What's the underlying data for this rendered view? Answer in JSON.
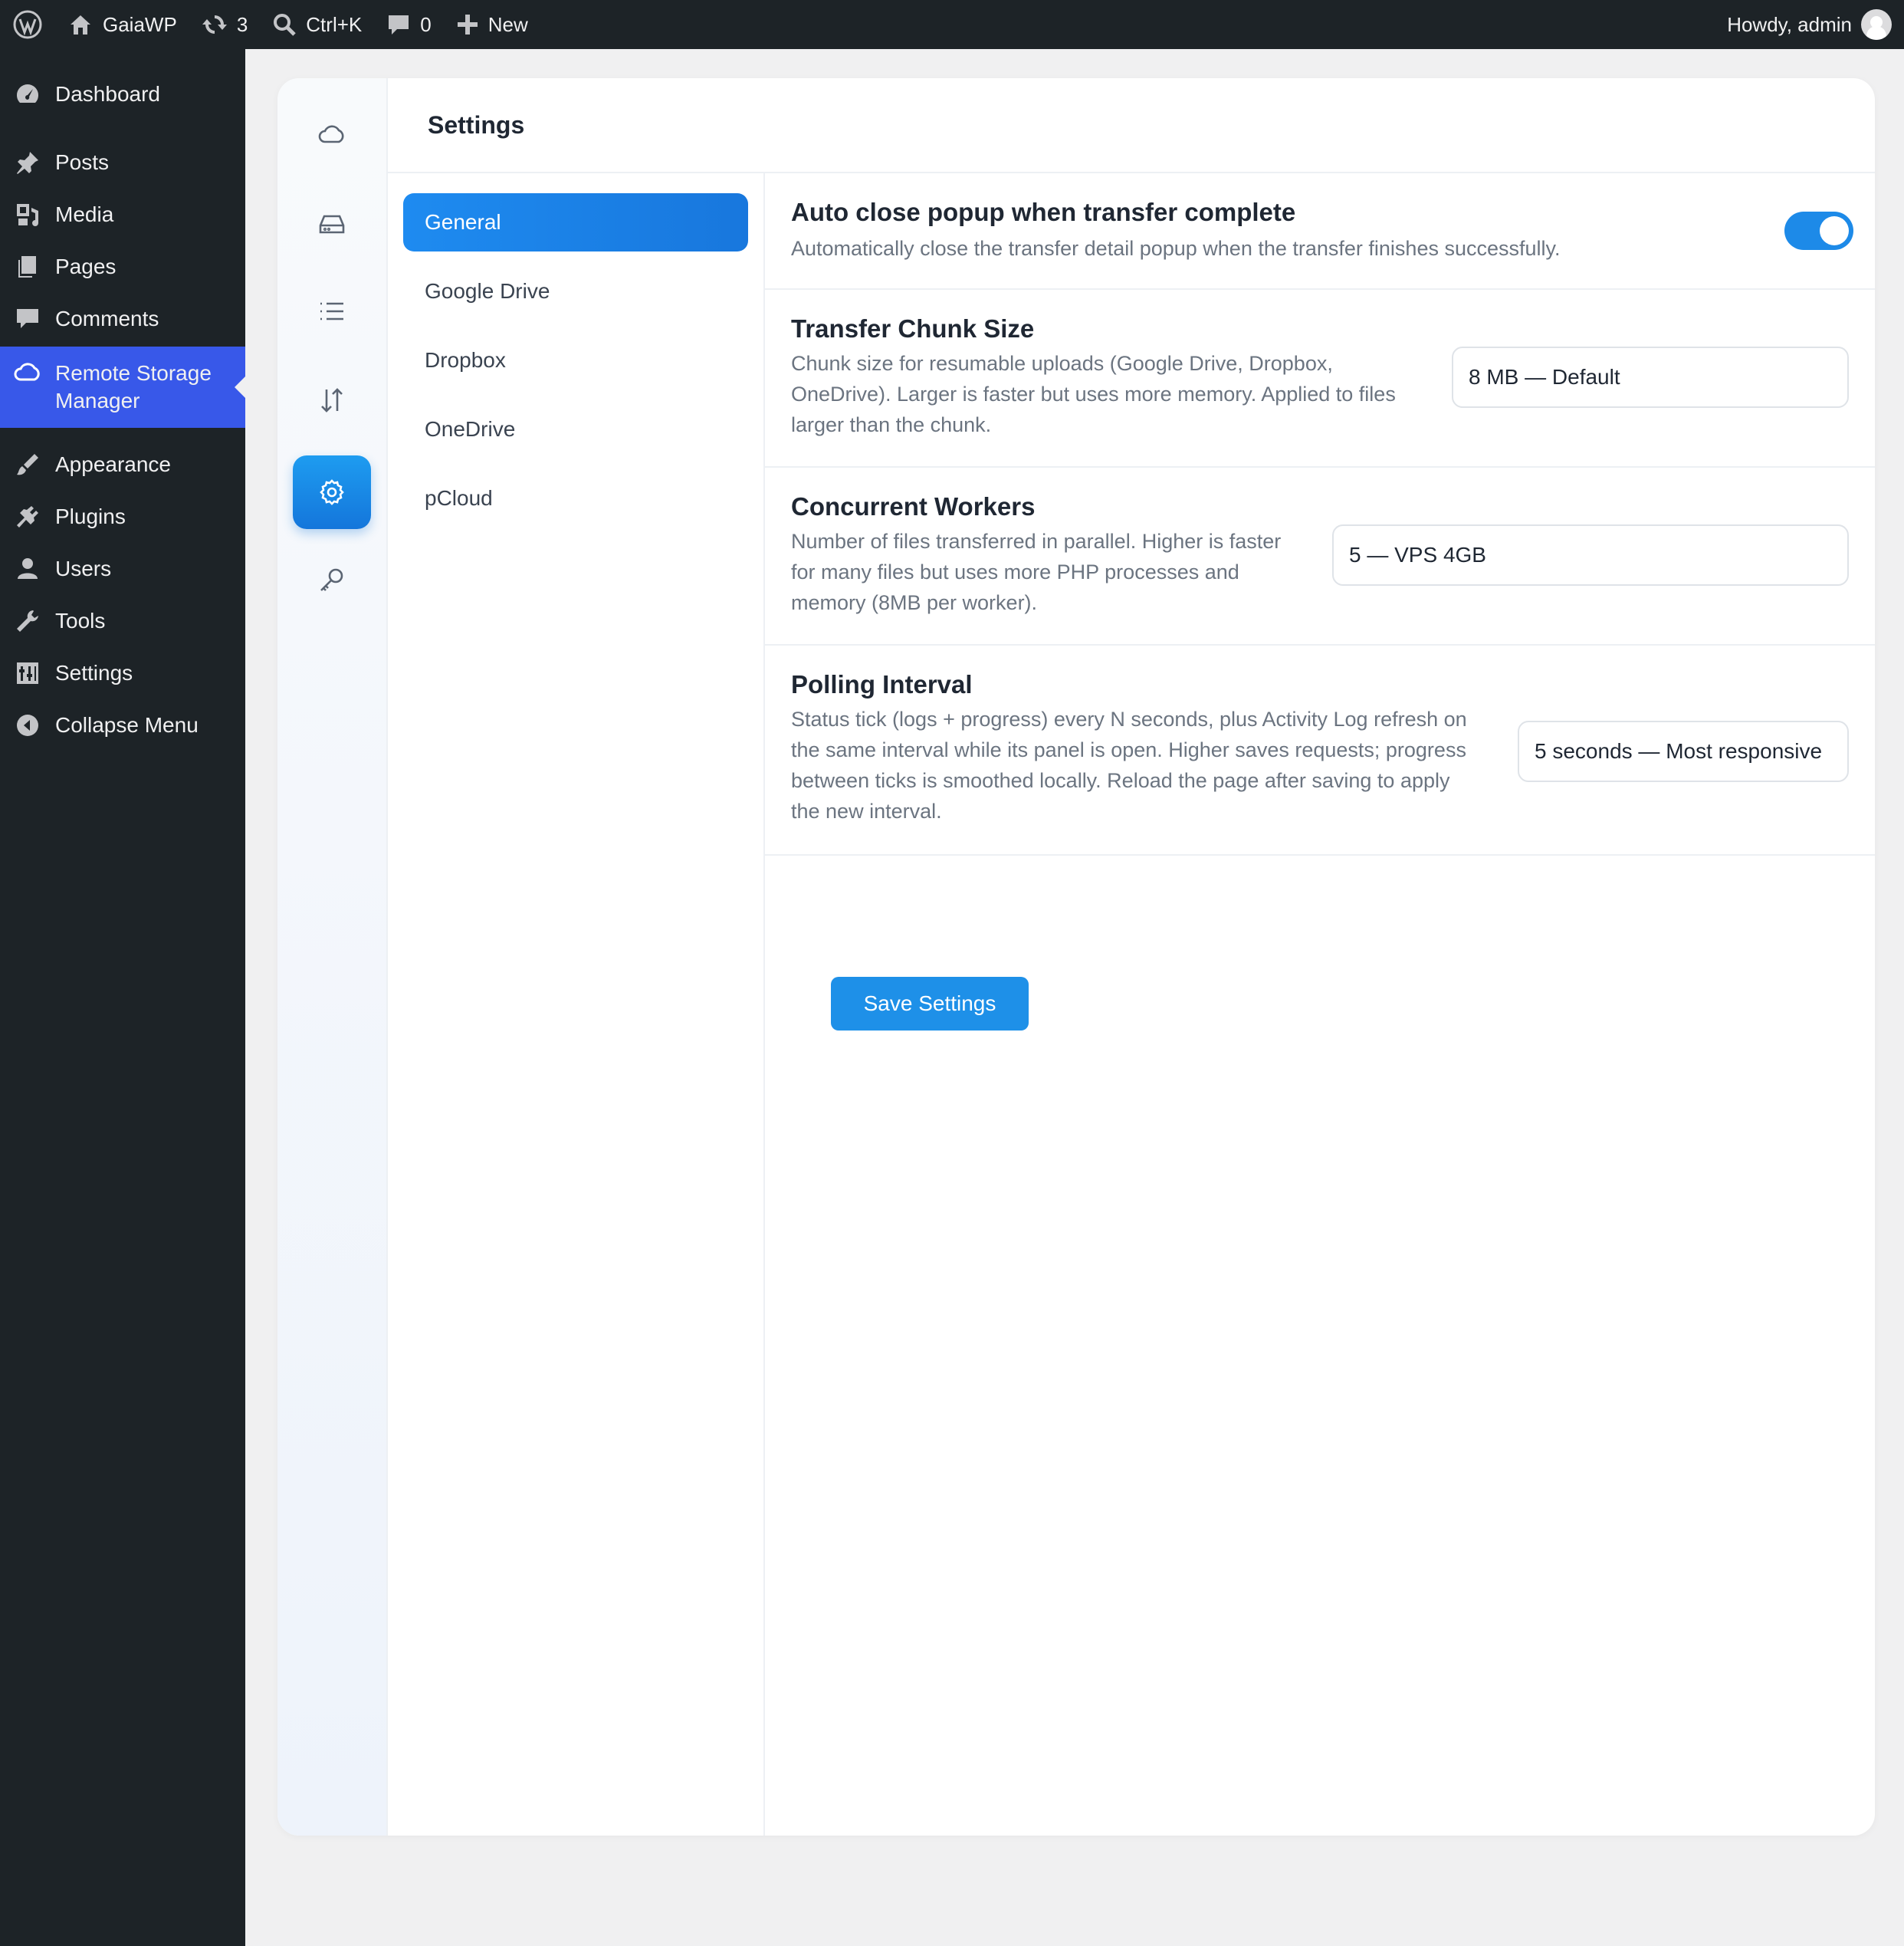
{
  "adminbar": {
    "site_name": "GaiaWP",
    "updates_count": "3",
    "search_shortcut": "Ctrl+K",
    "comments_count": "0",
    "new_label": "New",
    "howdy": "Howdy, admin"
  },
  "menu": {
    "dashboard": "Dashboard",
    "posts": "Posts",
    "media": "Media",
    "pages": "Pages",
    "comments": "Comments",
    "remote_storage_line1": "Remote Storage",
    "remote_storage_line2": "Manager",
    "appearance": "Appearance",
    "plugins": "Plugins",
    "users": "Users",
    "tools": "Tools",
    "settings": "Settings",
    "collapse": "Collapse Menu"
  },
  "page": {
    "title": "Settings"
  },
  "subnav": {
    "general": "General",
    "google_drive": "Google Drive",
    "dropbox": "Dropbox",
    "onedrive": "OneDrive",
    "pcloud": "pCloud"
  },
  "settings": {
    "auto_close": {
      "title": "Auto close popup when transfer complete",
      "desc": "Automatically close the transfer detail popup when the transfer finishes successfully.",
      "enabled": true
    },
    "chunk_size": {
      "title": "Transfer Chunk Size",
      "desc_1": "Chunk size for resumable uploads (Google Drive, Dropbox,",
      "desc_2": "OneDrive). Larger is faster but uses more memory. Applied to files",
      "desc_3": "larger than the chunk.",
      "value": "8 MB — Default"
    },
    "workers": {
      "title": "Concurrent Workers",
      "desc_1": "Number of files transferred in parallel. Higher is faster",
      "desc_2": "for many files but uses more PHP processes and",
      "desc_3": "memory (8MB per worker).",
      "value": "5 — VPS 4GB"
    },
    "polling": {
      "title": "Polling Interval",
      "desc_1": "Status tick (logs + progress) every N seconds, plus Activity Log refresh on",
      "desc_2": "the same interval while its panel is open. Higher saves requests; progress",
      "desc_3": "between ticks is smoothed locally. Reload the page after saving to apply",
      "desc_4": "the new interval.",
      "value": "5 seconds — Most responsive"
    },
    "save_label": "Save Settings"
  },
  "colors": {
    "accent": "#1e8bf0",
    "menu_current": "#3858e9",
    "admin_dark": "#1d2327"
  }
}
